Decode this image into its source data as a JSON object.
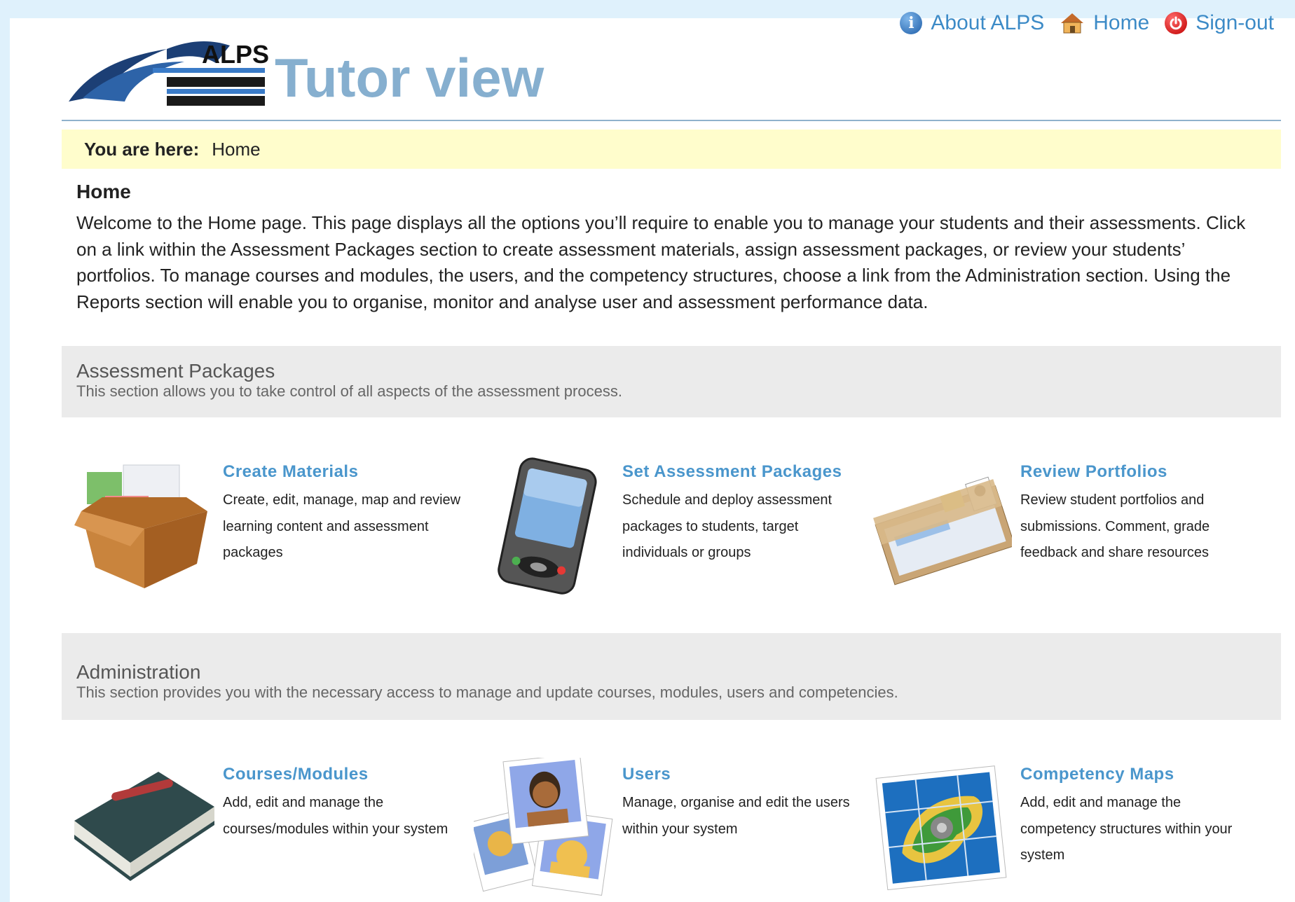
{
  "header": {
    "logo_text": "ALPS",
    "app_title": "Tutor view",
    "links": [
      {
        "label": "About ALPS",
        "icon": "info-icon"
      },
      {
        "label": "Home",
        "icon": "home-icon"
      },
      {
        "label": "Sign-out",
        "icon": "power-icon"
      }
    ]
  },
  "breadcrumb": {
    "label": "You are here:",
    "current": "Home"
  },
  "main": {
    "heading": "Home",
    "intro": "Welcome to the Home page. This page displays all the options you’ll require to enable you to manage your students and their assessments. Click on a link within the Assessment Packages section to create assessment materials, assign assessment packages, or review your students’ portfolios. To manage courses and modules, the users, and the competency structures, choose a link from the Administration section. Using the Reports section will enable you to organise, monitor and analyse user and assessment performance data."
  },
  "sections": [
    {
      "title": "Assessment Packages",
      "description": "This section allows you to take control of all aspects of the assessment process.",
      "tiles": [
        {
          "title": "Create Materials",
          "description": "Create, edit, manage, map and review learning content and assessment packages",
          "icon": "box-icon"
        },
        {
          "title": "Set Assessment Packages",
          "description": "Schedule and deploy assessment packages to students, target individuals or groups",
          "icon": "pda-icon"
        },
        {
          "title": "Review Portfolios",
          "description": "Review student portfolios and submissions. Comment, grade feedback and share resources",
          "icon": "folder-icon"
        }
      ]
    },
    {
      "title": "Administration",
      "description": "This section provides you with the necessary access to manage and update courses, modules, users and competencies.",
      "tiles": [
        {
          "title": "Courses/Modules",
          "description": "Add, edit and manage the courses/modules within your system",
          "icon": "book-icon"
        },
        {
          "title": "Users",
          "description": "Manage, organise and edit the users within your system",
          "icon": "users-photos-icon"
        },
        {
          "title": "Competency Maps",
          "description": "Add, edit and manage the competency structures within your system",
          "icon": "map-icon"
        }
      ]
    }
  ]
}
